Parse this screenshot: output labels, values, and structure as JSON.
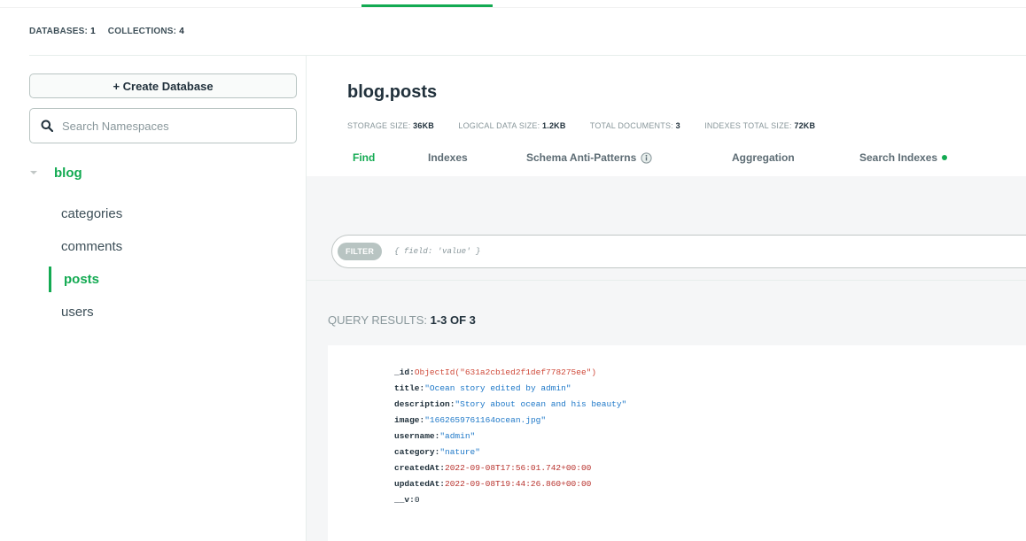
{
  "header": {
    "databases_label": "DATABASES:",
    "databases_count": "1",
    "collections_label": "COLLECTIONS:",
    "collections_count": "4"
  },
  "sidebar": {
    "create_button_label": "+ Create Database",
    "search_placeholder": "Search Namespaces",
    "database": "blog",
    "collections": [
      "categories",
      "comments",
      "posts",
      "users"
    ],
    "active_collection": "posts"
  },
  "collection": {
    "title": "blog.posts",
    "stats": {
      "storage_label": "STORAGE SIZE:",
      "storage_value": "36KB",
      "logical_label": "LOGICAL DATA SIZE:",
      "logical_value": "1.2KB",
      "docs_label": "TOTAL DOCUMENTS:",
      "docs_value": "3",
      "indexes_label": "INDEXES TOTAL SIZE:",
      "indexes_value": "72KB"
    },
    "tabs": [
      "Find",
      "Indexes",
      "Schema Anti-Patterns",
      "Aggregation",
      "Search Indexes"
    ],
    "active_tab": "Find"
  },
  "filter": {
    "badge": "FILTER",
    "placeholder": "{ field: 'value' }"
  },
  "results": {
    "label": "QUERY RESULTS:",
    "range": "1-3 OF 3"
  },
  "document": {
    "fields": [
      {
        "key": "_id:",
        "value": "ObjectId(\"631a2cb1ed2f1def778275ee\")"
      },
      {
        "key": "title:",
        "value": "\"Ocean story edited by admin\""
      },
      {
        "key": "description:",
        "value": "\"Story about ocean and his beauty\""
      },
      {
        "key": "image:",
        "value": "\"1662659761164ocean.jpg\""
      },
      {
        "key": "username:",
        "value": "\"admin\""
      },
      {
        "key": "category:",
        "value": "\"nature\""
      },
      {
        "key": "createdAt:",
        "value": "2022-09-08T17:56:01.742+00:00"
      },
      {
        "key": "updatedAt:",
        "value": "2022-09-08T19:44:26.860+00:00"
      },
      {
        "key": "__v:",
        "value": "0"
      }
    ]
  },
  "colors": {
    "accent": "#13aa52",
    "string": "#1e78c8",
    "objectid": "#cf4a3a",
    "date": "#b8332e"
  }
}
